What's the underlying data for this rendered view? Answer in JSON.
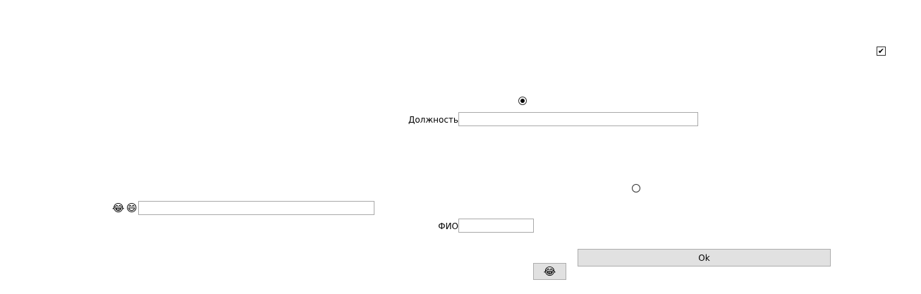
{
  "checkbox": {
    "checked": true,
    "icon": "check-icon",
    "mark": "✔"
  },
  "radios": [
    {
      "checked": true
    },
    {
      "checked": false
    }
  ],
  "position_field": {
    "label": "Должность",
    "value": ""
  },
  "fio_field": {
    "label": "ФИО",
    "value": ""
  },
  "left_field": {
    "emojis": [
      "😂",
      "😄"
    ],
    "value": ""
  },
  "buttons": {
    "ok_label": "Ok",
    "emoji_label": "😂"
  }
}
